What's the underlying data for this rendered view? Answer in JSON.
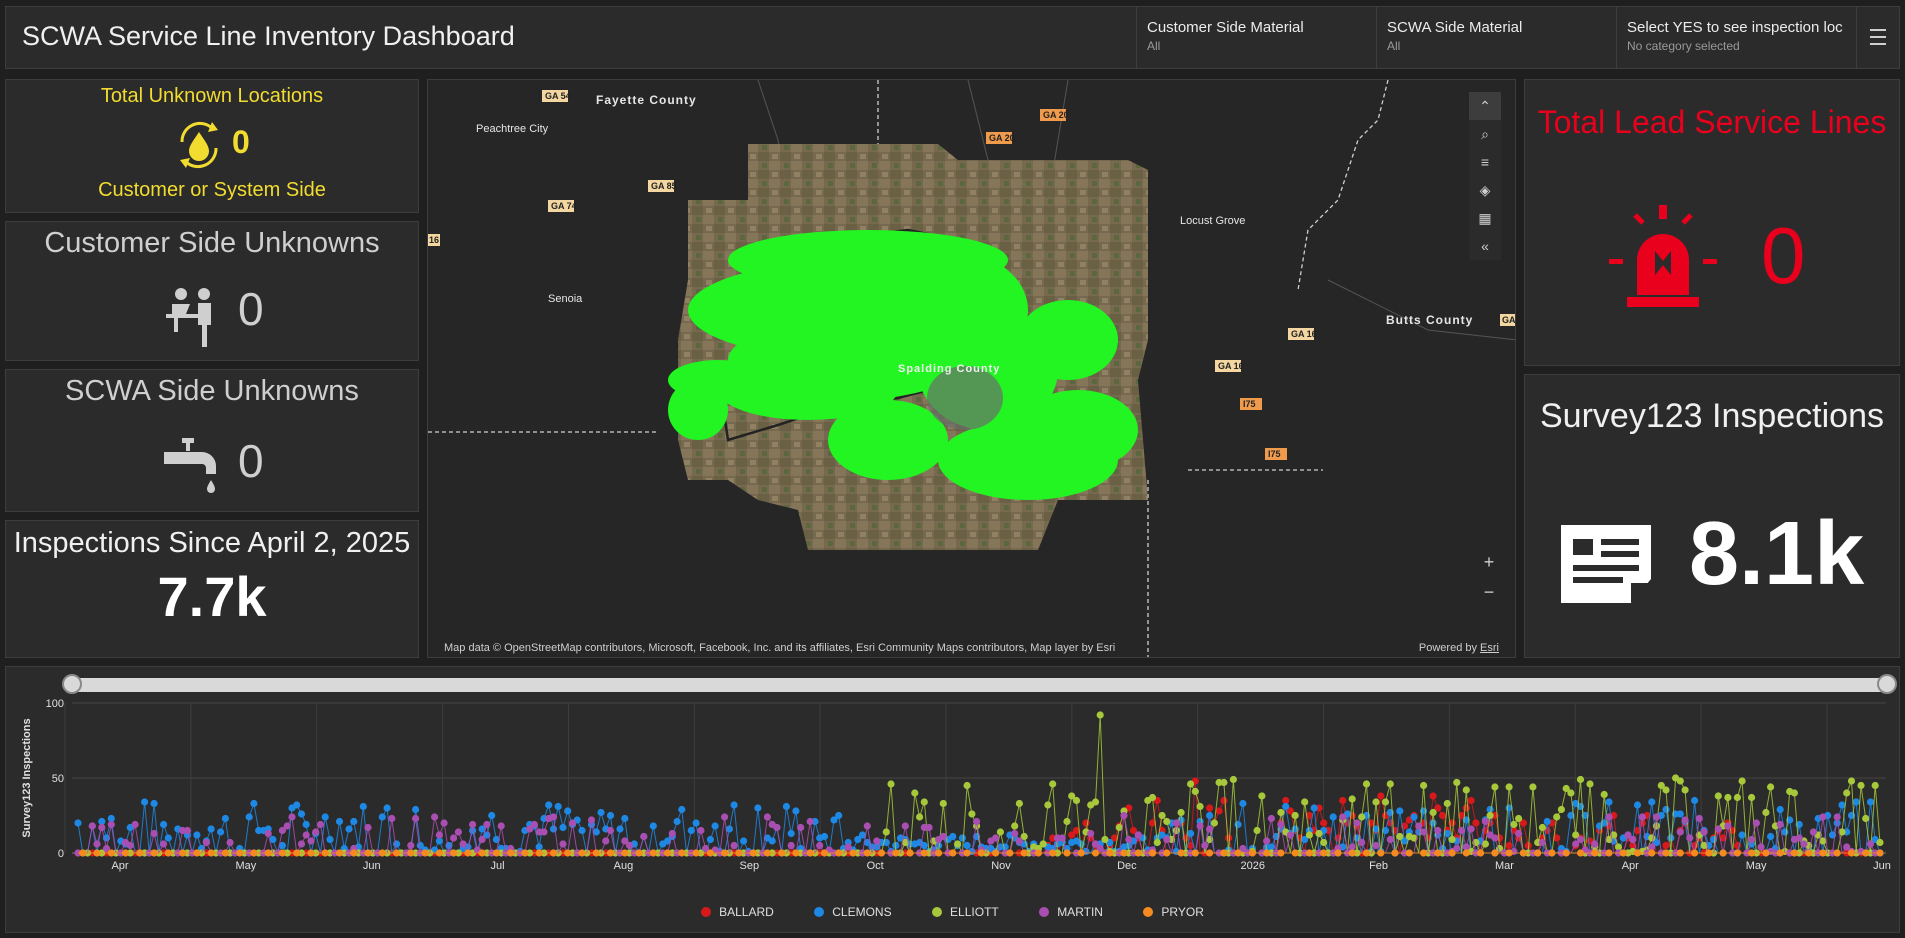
{
  "header": {
    "title": "SCWA Service Line Inventory Dashboard",
    "selectors": [
      {
        "label": "Customer Side Material",
        "value": "All"
      },
      {
        "label": "SCWA Side Material",
        "value": "All"
      },
      {
        "label": "Select YES to see inspection loc",
        "value": "No category selected"
      }
    ]
  },
  "unknown_total": {
    "title": "Total Unknown Locations",
    "value": "0",
    "subtitle": "Customer or System Side",
    "color": "#f2dc2f",
    "icon": "water-cycle-icon"
  },
  "customer_unknowns": {
    "title": "Customer Side Unknowns",
    "value": "0",
    "icon": "customer-service-icon"
  },
  "scwa_unknowns": {
    "title": "SCWA Side Unknowns",
    "value": "0",
    "icon": "faucet-icon"
  },
  "inspections_since": {
    "title": "Inspections Since April 2, 2025",
    "value": "7.7k"
  },
  "lead_lines": {
    "title": "Total Lead Service Lines",
    "value": "0",
    "color": "#e8001c",
    "icon": "siren-icon"
  },
  "survey": {
    "title": "Survey123 Inspections",
    "value": "8.1k",
    "icon": "form-icon"
  },
  "map": {
    "labels": [
      "Fayette County",
      "Peachtree City",
      "Locust Grove",
      "Senoia",
      "Butts County",
      "Spalding County"
    ],
    "road_shields": [
      "GA 54",
      "GA 20",
      "GA 20",
      "GA 85",
      "GA 74",
      "16",
      "GA 16",
      "GA 16",
      "I75",
      "I75",
      "GA"
    ],
    "attribution": "Map data © OpenStreetMap contributors, Microsoft, Facebook, Inc. and its affiliates, Esri Community Maps contributors, Map layer by Esri",
    "powered_by": "Powered by",
    "esri": "Esri",
    "zoom_in": "+",
    "zoom_out": "−",
    "point_color": "#22f522"
  },
  "chart_data": {
    "type": "line",
    "ylabel": "Survey123 Inspections",
    "yticks": [
      "0",
      "50",
      "100"
    ],
    "ylim": [
      0,
      100
    ],
    "x_tick_labels": [
      "Apr",
      "May",
      "Jun",
      "Jul",
      "Aug",
      "Sep",
      "Oct",
      "Nov",
      "Dec",
      "2026",
      "Feb",
      "Mar",
      "Apr",
      "May",
      "Jun"
    ],
    "x_start": "2025-04-02",
    "grid": true,
    "legend_position": "bottom",
    "series": [
      {
        "name": "BALLARD",
        "color": "#d7191c",
        "values": [
          0,
          0,
          0,
          0,
          0,
          0,
          0,
          0,
          0,
          0,
          0,
          0,
          0,
          0,
          0,
          0,
          0,
          0,
          0,
          0,
          0,
          0,
          0,
          0,
          0,
          0,
          0,
          0,
          0,
          0,
          0,
          0,
          0,
          0,
          0,
          0,
          0,
          0,
          0,
          0,
          0,
          0,
          0,
          0,
          0,
          0,
          0,
          0,
          0,
          0,
          0,
          0,
          0,
          0,
          0,
          0,
          0,
          0,
          0,
          0,
          0,
          0,
          0,
          0,
          0,
          0,
          0,
          0,
          0,
          0,
          0,
          0,
          0,
          0,
          0,
          0,
          0,
          0,
          0,
          0,
          0,
          0,
          0,
          0,
          0,
          0,
          0,
          0,
          0,
          0,
          0,
          0,
          0,
          0,
          0,
          0,
          0,
          0,
          0,
          0,
          0,
          0,
          0,
          0,
          0,
          0,
          0,
          0,
          0,
          0,
          0,
          0,
          0,
          0,
          0,
          0,
          0,
          0,
          0,
          0,
          0,
          0,
          0,
          0,
          0,
          0,
          0,
          0,
          0,
          0,
          0,
          0,
          0,
          0,
          0,
          0,
          0,
          0,
          0,
          0,
          0,
          0,
          0,
          0,
          0,
          0,
          0,
          0,
          0,
          0,
          0,
          0,
          0,
          0,
          0,
          0,
          0,
          0,
          0,
          0,
          0,
          0,
          0,
          0,
          0,
          0,
          0,
          0,
          0,
          0,
          0,
          0,
          0,
          0,
          0,
          0,
          0,
          0,
          0,
          0,
          0,
          0,
          0,
          0,
          0,
          0,
          0,
          0,
          0,
          0,
          0,
          0,
          0,
          0,
          0,
          0,
          0,
          0,
          0,
          0,
          0,
          0,
          0,
          0,
          5,
          10,
          0,
          8,
          0,
          12,
          15,
          0,
          20,
          10,
          5,
          0,
          0,
          5,
          10,
          18,
          25,
          30,
          15,
          10,
          0,
          0,
          20,
          35,
          15,
          0,
          0,
          15,
          20,
          10,
          5,
          48,
          0,
          0,
          30,
          20,
          28,
          35,
          10,
          0,
          0,
          0,
          0,
          0,
          0,
          0,
          0,
          0,
          0,
          20,
          35,
          28,
          15,
          10,
          0,
          25,
          15,
          30,
          20,
          15,
          0,
          10,
          35,
          20,
          25,
          18,
          0,
          0,
          20,
          15,
          38,
          25,
          20,
          15,
          0,
          18,
          22,
          25,
          15,
          20,
          10,
          38,
          30,
          25,
          15,
          20,
          10,
          25,
          30,
          35,
          20,
          0,
          15,
          20,
          25,
          10,
          0,
          5,
          15,
          10,
          20,
          5,
          0,
          0,
          10,
          15,
          20,
          10,
          0,
          0,
          0,
          5,
          10,
          0,
          8,
          0,
          15,
          20,
          18,
          25,
          0,
          0,
          10,
          5,
          15,
          20,
          25,
          10,
          0,
          0,
          5,
          10,
          0,
          15,
          20,
          0,
          5,
          10,
          0,
          5,
          10,
          15,
          10,
          20,
          15,
          5
        ]
      },
      {
        "name": "CLEMONS",
        "color": "#1e88e5",
        "values": []
      },
      {
        "name": "ELLIOTT",
        "color": "#a6c83a",
        "values": []
      },
      {
        "name": "MARTIN",
        "color": "#a94fb2",
        "values": []
      },
      {
        "name": "PRYOR",
        "color": "#f58b1f",
        "values": []
      }
    ]
  }
}
